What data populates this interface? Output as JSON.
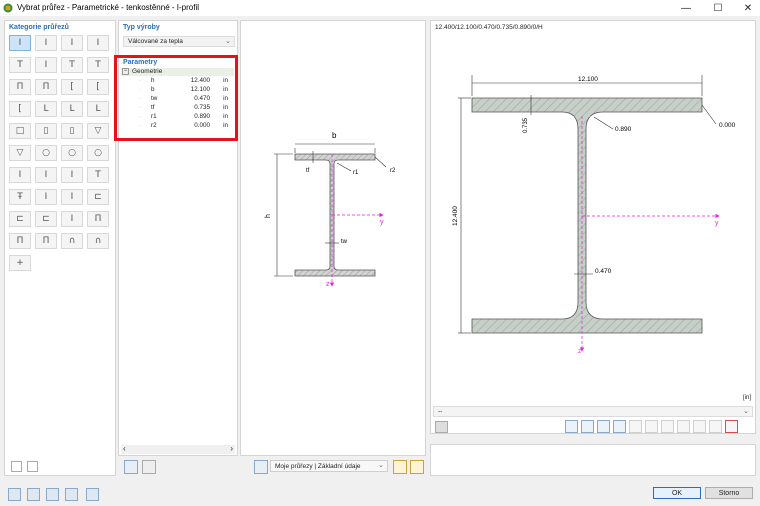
{
  "window": {
    "title": "Vybrat průřez - Parametrické - tenkostěnné - I-profil",
    "minimize": "—",
    "maximize": "☐",
    "close": "✕"
  },
  "categories": {
    "header": "Kategorie průřezů",
    "icon_glyphs": [
      "I",
      "I",
      "I",
      "I",
      "T",
      "I",
      "T",
      "T",
      "Π",
      "Π",
      "[",
      "[",
      "[",
      "L",
      "L",
      "L",
      "□",
      "▯",
      "▯",
      "▽",
      "▽",
      "○",
      "○",
      "○",
      "I",
      "I",
      "I",
      "T",
      "Ŧ",
      "I",
      "I",
      "⊏",
      "⊏",
      "⊏",
      "I",
      "Π",
      "Π",
      "Π",
      "∩",
      "∩",
      "+"
    ]
  },
  "fabrication": {
    "header": "Typ výroby",
    "selected": "Válcované za tepla"
  },
  "parameters": {
    "header": "Parametry",
    "group": "Geometrie",
    "rows": [
      {
        "symbol": "h",
        "value": "12.400",
        "unit": "in"
      },
      {
        "symbol": "b",
        "value": "12.100",
        "unit": "in"
      },
      {
        "symbol": "tw",
        "value": "0.470",
        "unit": "in"
      },
      {
        "symbol": "tf",
        "value": "0.735",
        "unit": "in"
      },
      {
        "symbol": "r1",
        "value": "0.890",
        "unit": "in"
      },
      {
        "symbol": "r2",
        "value": "0.000",
        "unit": "in"
      }
    ]
  },
  "schematic": {
    "b": "b",
    "h": "h",
    "tf": "tf",
    "tw": "tw",
    "r1": "r1",
    "r2": "r2",
    "y": "y",
    "z": "z"
  },
  "preview": {
    "section_string": "12.400/12.100/0.470/0.735/0.890/0/H",
    "dim_width": "12.100",
    "dim_height": "12.400",
    "dim_tf": "0.735",
    "dim_r1": "0.890",
    "dim_r2": "0.000",
    "dim_tw": "0.470",
    "axis_y": "y",
    "axis_z": "z",
    "units": "[in]",
    "dropdown_value": "--"
  },
  "library": {
    "selected": "Moje průřezy | Základní údaje"
  },
  "footer": {
    "ok": "OK",
    "cancel": "Storno"
  },
  "colors": {
    "accent": "#2a6ebb",
    "highlight": "#e0141e",
    "section_fill": "#c7cfc9",
    "axis": "#e020e0"
  }
}
